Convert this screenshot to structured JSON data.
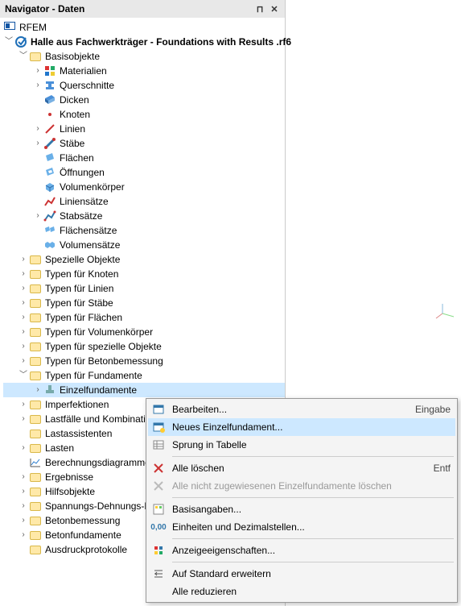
{
  "titlebar": {
    "title": "Navigator - Daten",
    "pin": "⊓",
    "close": "✕"
  },
  "root_app": "RFEM",
  "project": "Halle aus Fachwerkträger - Foundations with Results .rf6",
  "tree": {
    "basis": "Basisobjekte",
    "materialien": "Materialien",
    "querschnitte": "Querschnitte",
    "dicken": "Dicken",
    "knoten": "Knoten",
    "linien": "Linien",
    "staebe": "Stäbe",
    "flaechen": "Flächen",
    "oeffnungen": "Öffnungen",
    "volumenkoerper": "Volumenkörper",
    "liniensaetze": "Liniensätze",
    "stabsaetze": "Stabsätze",
    "flaechensaetze": "Flächensätze",
    "volumensaetze": "Volumensätze",
    "spezielle": "Spezielle Objekte",
    "typ_knoten": "Typen für Knoten",
    "typ_linien": "Typen für Linien",
    "typ_staebe": "Typen für Stäbe",
    "typ_flaechen": "Typen für Flächen",
    "typ_volumen": "Typen für Volumenkörper",
    "typ_spezielle": "Typen für spezielle Objekte",
    "typ_beton": "Typen für Betonbemessung",
    "typ_fund": "Typen für Fundamente",
    "einzel": "Einzelfundamente",
    "imperf": "Imperfektionen",
    "lastfaelle": "Lastfälle und Kombinationen",
    "lastassist": "Lastassistenten",
    "lasten": "Lasten",
    "berechnung": "Berechnungsdiagramme",
    "ergebnisse": "Ergebnisse",
    "hilfs": "Hilfsobjekte",
    "spannung": "Spannungs-Dehnungs-Beziehungen",
    "betonbem": "Betonbemessung",
    "betonfund": "Betonfundamente",
    "ausdruck": "Ausdruckprotokolle"
  },
  "ctx": {
    "edit": "Bearbeiten...",
    "edit_short": "Eingabe",
    "new": "Neues Einzelfundament...",
    "jump": "Sprung in Tabelle",
    "delall": "Alle löschen",
    "delall_short": "Entf",
    "delunused": "Alle nicht zugewiesenen Einzelfundamente löschen",
    "basic": "Basisangaben...",
    "units": "Einheiten und Dezimalstellen...",
    "display": "Anzeigeeigenschaften...",
    "expand": "Auf Standard erweitern",
    "collapse": "Alle reduzieren"
  }
}
